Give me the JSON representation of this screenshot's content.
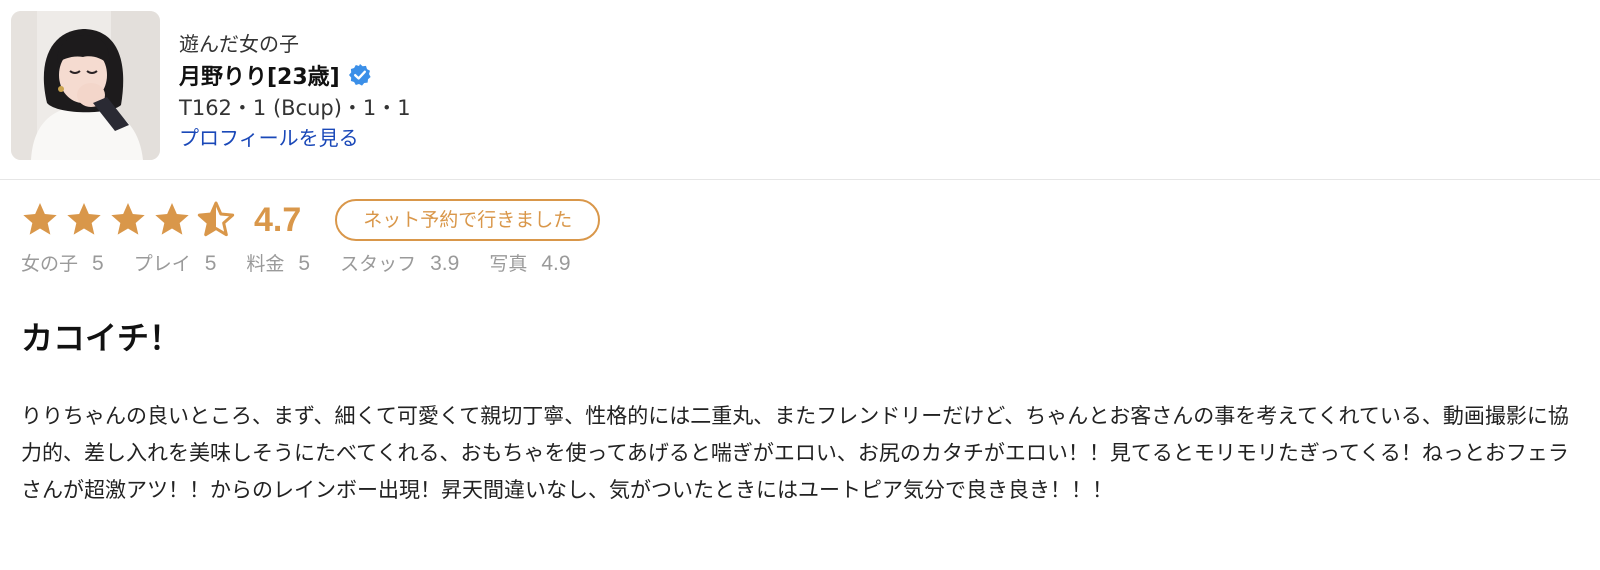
{
  "profile": {
    "kicker": "遊んだ女の子",
    "name": "月野りり[23歳]",
    "stats": "T162・1 (Bcup)・1・1",
    "link_label": "プロフィールを見る"
  },
  "rating": {
    "stars_out_of_5": 4.5,
    "score": "4.7",
    "badge": "ネット予約で行きました",
    "color": "#d9974a"
  },
  "sub_ratings": [
    {
      "label": "女の子",
      "value": "5"
    },
    {
      "label": "プレイ",
      "value": "5"
    },
    {
      "label": "料金",
      "value": "5"
    },
    {
      "label": "スタッフ",
      "value": "3.9"
    },
    {
      "label": "写真",
      "value": "4.9"
    }
  ],
  "review": {
    "title": "カコイチ！",
    "body": "りりちゃんの良いところ、まず、細くて可愛くて親切丁寧、性格的には二重丸、またフレンドリーだけど、ちゃんとお客さんの事を考えてくれている、動画撮影に協力的、差し入れを美味しそうにたべてくれる、おもちゃを使ってあげると喘ぎがエロい、お尻のカタチがエロい！！見てるとモリモリたぎってくる！ねっとおフェラさんが超激アツ！！からのレインボー出現！昇天間違いなし、気がついたときにはユートピア気分で良き良き！！！"
  },
  "icons": {
    "verified": "verified-check-icon",
    "star": "star-icon",
    "accent": "#d9974a",
    "verified_color": "#3b8fe8",
    "link_color": "#1a48b8"
  }
}
